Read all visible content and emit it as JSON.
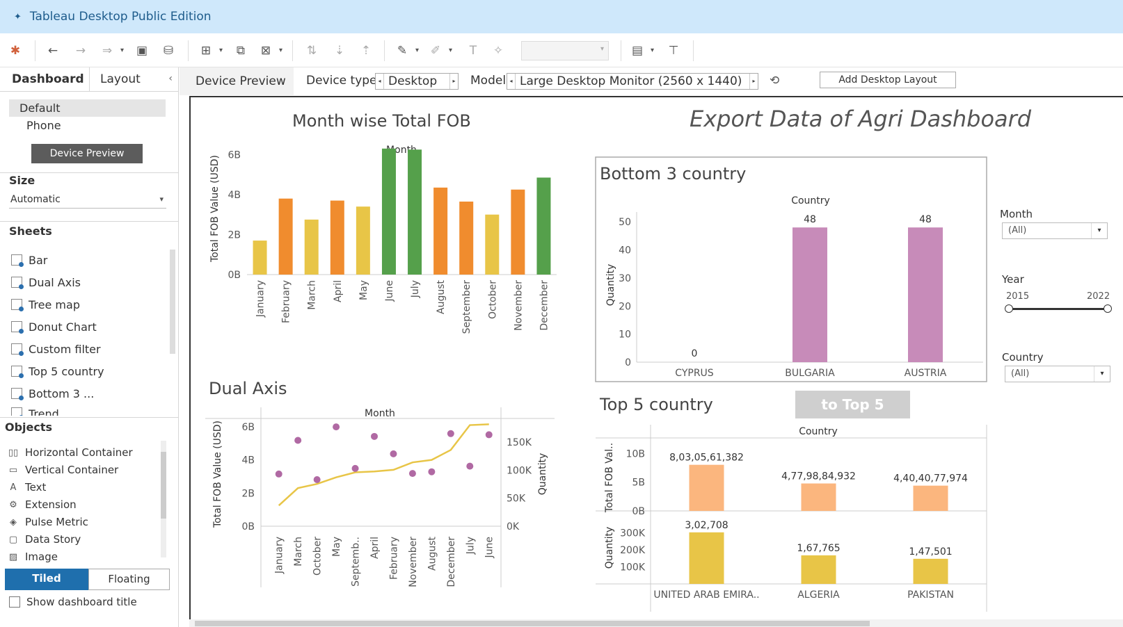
{
  "app": {
    "title": "Tableau Desktop Public Edition"
  },
  "toolbar": {
    "icons": [
      "tableau-logo-icon",
      "undo-icon",
      "redo-icon",
      "replay-icon",
      "save-icon",
      "new-datasource-icon",
      "new-worksheet-icon",
      "duplicate-icon",
      "clear-icon",
      "swap-icon",
      "sort-asc-icon",
      "sort-desc-icon",
      "highlight-icon",
      "annotate-icon",
      "label-icon",
      "pin-icon",
      "show-cards-icon",
      "presentation-icon"
    ]
  },
  "side": {
    "tabs": [
      "Dashboard",
      "Layout"
    ],
    "devices": [
      "Default",
      "Phone"
    ],
    "device_preview_button": "Device Preview",
    "size_heading": "Size",
    "size_value": "Automatic",
    "sheets_heading": "Sheets",
    "sheets": [
      "Bar",
      "Dual Axis",
      "Tree map",
      "Donut Chart",
      "Custom filter",
      "Top 5 country",
      "Bottom 3 ...",
      "Trend"
    ],
    "objects_heading": "Objects",
    "objects": [
      {
        "label": "Horizontal Container",
        "icon": "horizontal-container-icon"
      },
      {
        "label": "Vertical Container",
        "icon": "vertical-container-icon"
      },
      {
        "label": "Text",
        "icon": "text-icon"
      },
      {
        "label": "Extension",
        "icon": "extension-icon"
      },
      {
        "label": "Pulse Metric",
        "icon": "pulse-metric-icon"
      },
      {
        "label": "Data Story",
        "icon": "data-story-icon"
      },
      {
        "label": "Image",
        "icon": "image-icon"
      }
    ],
    "tiled": "Tiled",
    "floating": "Floating",
    "show_title": "Show dashboard title"
  },
  "devbar": {
    "preview": "Device Preview",
    "device_type_label": "Device type",
    "device_type": "Desktop",
    "model_label": "Model",
    "model": "Large Desktop Monitor (2560 x 1440)",
    "add_layout": "Add Desktop Layout"
  },
  "dashboard": {
    "title": "Export Data of Agri Dashboard",
    "filters": {
      "month_label": "Month",
      "month_value": "(All)",
      "year_label": "Year",
      "year_min": "2015",
      "year_max": "2022",
      "country_label": "Country",
      "country_value": "(All)"
    },
    "to_top5_button": "to Top 5"
  },
  "chart_data": [
    {
      "id": "month-wise",
      "type": "bar",
      "title": "Month wise Total FOB",
      "header": "Month",
      "ylabel": "Total FOB Value (USD)",
      "yticks": [
        "0B",
        "2B",
        "4B",
        "6B"
      ],
      "ylim": [
        0,
        6.5
      ],
      "categories": [
        "January",
        "February",
        "March",
        "April",
        "May",
        "June",
        "July",
        "August",
        "September",
        "October",
        "November",
        "December"
      ],
      "values": [
        1.7,
        3.8,
        2.75,
        3.7,
        3.4,
        6.3,
        6.25,
        4.35,
        3.65,
        3.0,
        4.25,
        4.85
      ],
      "colors": [
        "#e8c547",
        "#f08c2e",
        "#e8c547",
        "#f08c2e",
        "#e8c547",
        "#55a04b",
        "#55a04b",
        "#f08c2e",
        "#f08c2e",
        "#e8c547",
        "#f08c2e",
        "#55a04b"
      ]
    },
    {
      "id": "dual-axis",
      "type": "line",
      "title": "Dual Axis",
      "header": "Month",
      "ylabel": "Total FOB Value (USD)",
      "y2label": "Quantity",
      "yticks": [
        "0B",
        "2B",
        "4B",
        "6B"
      ],
      "y2ticks": [
        "0K",
        "50K",
        "100K",
        "150K"
      ],
      "ylim": [
        0,
        6.5
      ],
      "y2lim": [
        0,
        192000
      ],
      "categories": [
        "January",
        "March",
        "October",
        "May",
        "Septemb..",
        "April",
        "February",
        "November",
        "August",
        "December",
        "July",
        "June"
      ],
      "series": [
        {
          "name": "Total FOB Value (USD)",
          "values": [
            1.25,
            2.3,
            2.55,
            2.95,
            3.25,
            3.3,
            3.4,
            3.85,
            4.0,
            4.6,
            6.1,
            6.15
          ],
          "color": "#e8c547"
        },
        {
          "name": "Quantity",
          "values": [
            93000,
            153000,
            83000,
            177000,
            103000,
            160000,
            129000,
            94000,
            97000,
            165000,
            107000,
            163000
          ],
          "color": "#b069a3"
        }
      ]
    },
    {
      "id": "bottom3",
      "type": "bar",
      "title": "Bottom 3 country",
      "header": "Country",
      "ylabel": "Quantity",
      "yticks": [
        "0",
        "10",
        "20",
        "30",
        "40",
        "50"
      ],
      "ylim": [
        0,
        54
      ],
      "categories": [
        "CYPRUS",
        "BULGARIA",
        "AUSTRIA"
      ],
      "values": [
        0,
        48,
        48
      ],
      "labels": [
        "0",
        "48",
        "48"
      ],
      "color": "#c78bb9"
    },
    {
      "id": "top5",
      "type": "bar",
      "title": "Top 5 country",
      "header": "Country",
      "categories": [
        "UNITED ARAB EMIRA..",
        "ALGERIA",
        "PAKISTAN"
      ],
      "series": [
        {
          "name": "Total FOB Val..",
          "yticks": [
            "0B",
            "5B",
            "10B"
          ],
          "ylim": [
            0,
            11.5
          ],
          "values": [
            8.03,
            4.78,
            4.4
          ],
          "labels": [
            "8,03,05,61,382",
            "4,77,98,84,932",
            "4,40,40,77,974"
          ],
          "color": "#fbb67e"
        },
        {
          "name": "Quantity",
          "yticks": [
            "100K",
            "200K",
            "300K"
          ],
          "ylim": [
            0,
            400000
          ],
          "values": [
            302708,
            167765,
            147501
          ],
          "labels": [
            "3,02,708",
            "1,67,765",
            "1,47,501"
          ],
          "color": "#e8c547"
        }
      ]
    }
  ]
}
